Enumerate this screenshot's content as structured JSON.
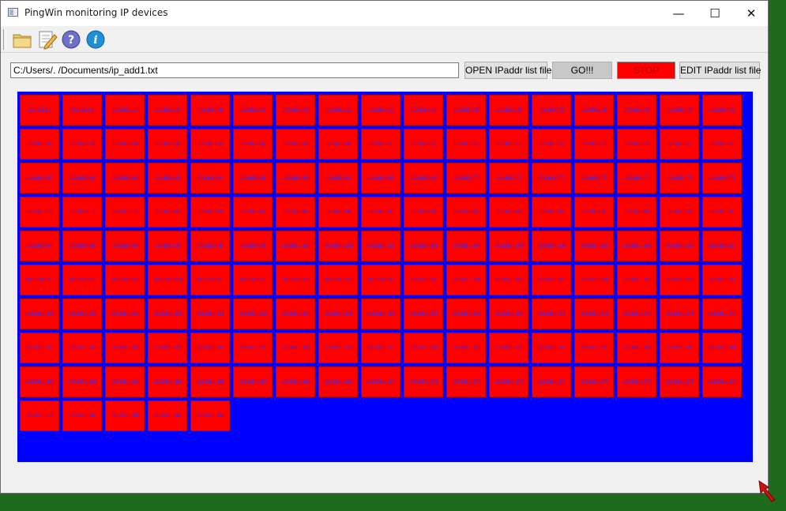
{
  "window": {
    "title": "PingWin monitoring IP devices",
    "controls": {
      "minimize": "—",
      "maximize": "☐",
      "close": "✕"
    }
  },
  "toolbar": {
    "icons": [
      "open-folder-icon",
      "edit-icon",
      "help-icon",
      "info-icon"
    ]
  },
  "pathbar": {
    "file_path": "C:/Users/.      /Documents/ip_add1.txt",
    "open_label": "OPEN IPaddr list file",
    "go_label": "GO!!!",
    "stop_label": "STOP",
    "edit_label": "EDIT IPaddr list file"
  },
  "colors": {
    "panel_background": "#0000ff",
    "tile_down": "#ff0000",
    "tile_text": "#2b2bff",
    "stop_button": "#ff0000"
  },
  "devices": [
    "192.168.1.1",
    "192.168.1.2",
    "192.168.1.10",
    "192.168.1.20",
    "192.168.1.25",
    "192.168.1.30",
    "192.168.1.31",
    "192.168.1.32",
    "192.168.1.33",
    "192.168.1.34",
    "192.168.1.35",
    "192.168.1.36",
    "192.168.1.37",
    "192.168.1.38",
    "192.168.1.39",
    "192.168.1.40",
    "192.168.1.41",
    "192.168.1.42",
    "192.168.1.43",
    "192.168.1.44",
    "192.168.1.45",
    "192.168.1.46",
    "192.168.1.47",
    "192.168.1.48",
    "192.168.1.49",
    "192.168.1.50",
    "192.168.1.51",
    "192.168.1.52",
    "192.168.1.53",
    "192.168.1.54",
    "192.168.1.55",
    "192.168.1.56",
    "192.168.1.57",
    "192.168.1.58",
    "192.168.1.60",
    "192.168.1.61",
    "192.168.1.62",
    "192.168.1.63",
    "192.168.1.64",
    "192.168.1.65",
    "192.168.1.66",
    "192.168.1.67",
    "192.168.1.68",
    "192.168.1.69",
    "192.168.1.70",
    "192.168.1.71",
    "192.168.1.72",
    "192.168.1.73",
    "192.168.1.74",
    "192.168.1.75",
    "192.168.1.76",
    "192.168.1.77",
    "192.168.1.78",
    "192.168.1.79",
    "192.168.1.80",
    "192.168.1.81",
    "192.168.1.82",
    "192.168.1.83",
    "192.168.1.84",
    "192.168.1.85",
    "192.168.1.86",
    "192.168.1.87",
    "192.168.1.88",
    "192.168.1.89",
    "192.168.1.90",
    "192.168.1.91",
    "192.168.1.92",
    "192.168.1.93",
    "192.168.1.94",
    "192.168.1.95",
    "192.168.1.96",
    "192.168.1.97",
    "192.168.1.98",
    "192.168.1.99",
    "192.168.1.100",
    "192.168.1.101",
    "192.168.1.102",
    "192.168.1.103",
    "192.168.1.104",
    "192.168.1.105",
    "192.168.1.106",
    "192.168.1.107",
    "192.168.1.108",
    "192.168.1.109",
    "192.168.1.110",
    "192.168.1.111",
    "192.168.1.112",
    "192.168.1.113",
    "192.168.1.114",
    "192.168.1.115",
    "192.168.1.116",
    "192.168.1.117",
    "192.168.1.118",
    "192.168.1.119",
    "192.168.1.120",
    "192.168.1.121",
    "192.168.1.122",
    "192.168.1.123",
    "192.168.1.124",
    "192.168.1.125",
    "192.168.1.126",
    "192.168.1.127",
    "192.168.1.128",
    "192.168.1.129",
    "192.168.1.130",
    "192.168.1.131",
    "192.168.1.132",
    "192.168.1.133",
    "192.168.1.134",
    "192.168.1.135",
    "192.168.1.136",
    "192.168.1.137",
    "192.168.1.138",
    "192.168.1.139",
    "192.168.1.140",
    "192.168.1.141",
    "192.168.1.142",
    "192.168.1.143",
    "192.168.1.144",
    "192.168.1.145",
    "192.168.1.146",
    "192.168.1.147",
    "192.168.1.148",
    "192.168.1.149",
    "192.168.1.150",
    "192.168.1.151",
    "192.168.1.152",
    "192.168.1.153",
    "192.168.1.154",
    "192.168.1.155",
    "192.168.1.156",
    "192.168.1.157",
    "192.168.1.158",
    "192.168.1.159",
    "192.168.1.160",
    "192.168.1.161",
    "192.168.1.162",
    "192.168.1.163",
    "192.168.1.164",
    "192.168.1.165",
    "192.168.1.166",
    "192.168.1.167",
    "192.168.1.168",
    "192.168.1.169",
    "192.168.1.170",
    "192.168.1.171",
    "192.168.1.172",
    "192.168.1.173",
    "192.168.1.174",
    "192.168.1.175",
    "192.168.1.176",
    "192.168.1.177",
    "192.168.1.178",
    "192.168.1.179",
    "192.168.1.180",
    "192.168.1.181",
    "192.168.1.182",
    "192.168.1.183"
  ]
}
